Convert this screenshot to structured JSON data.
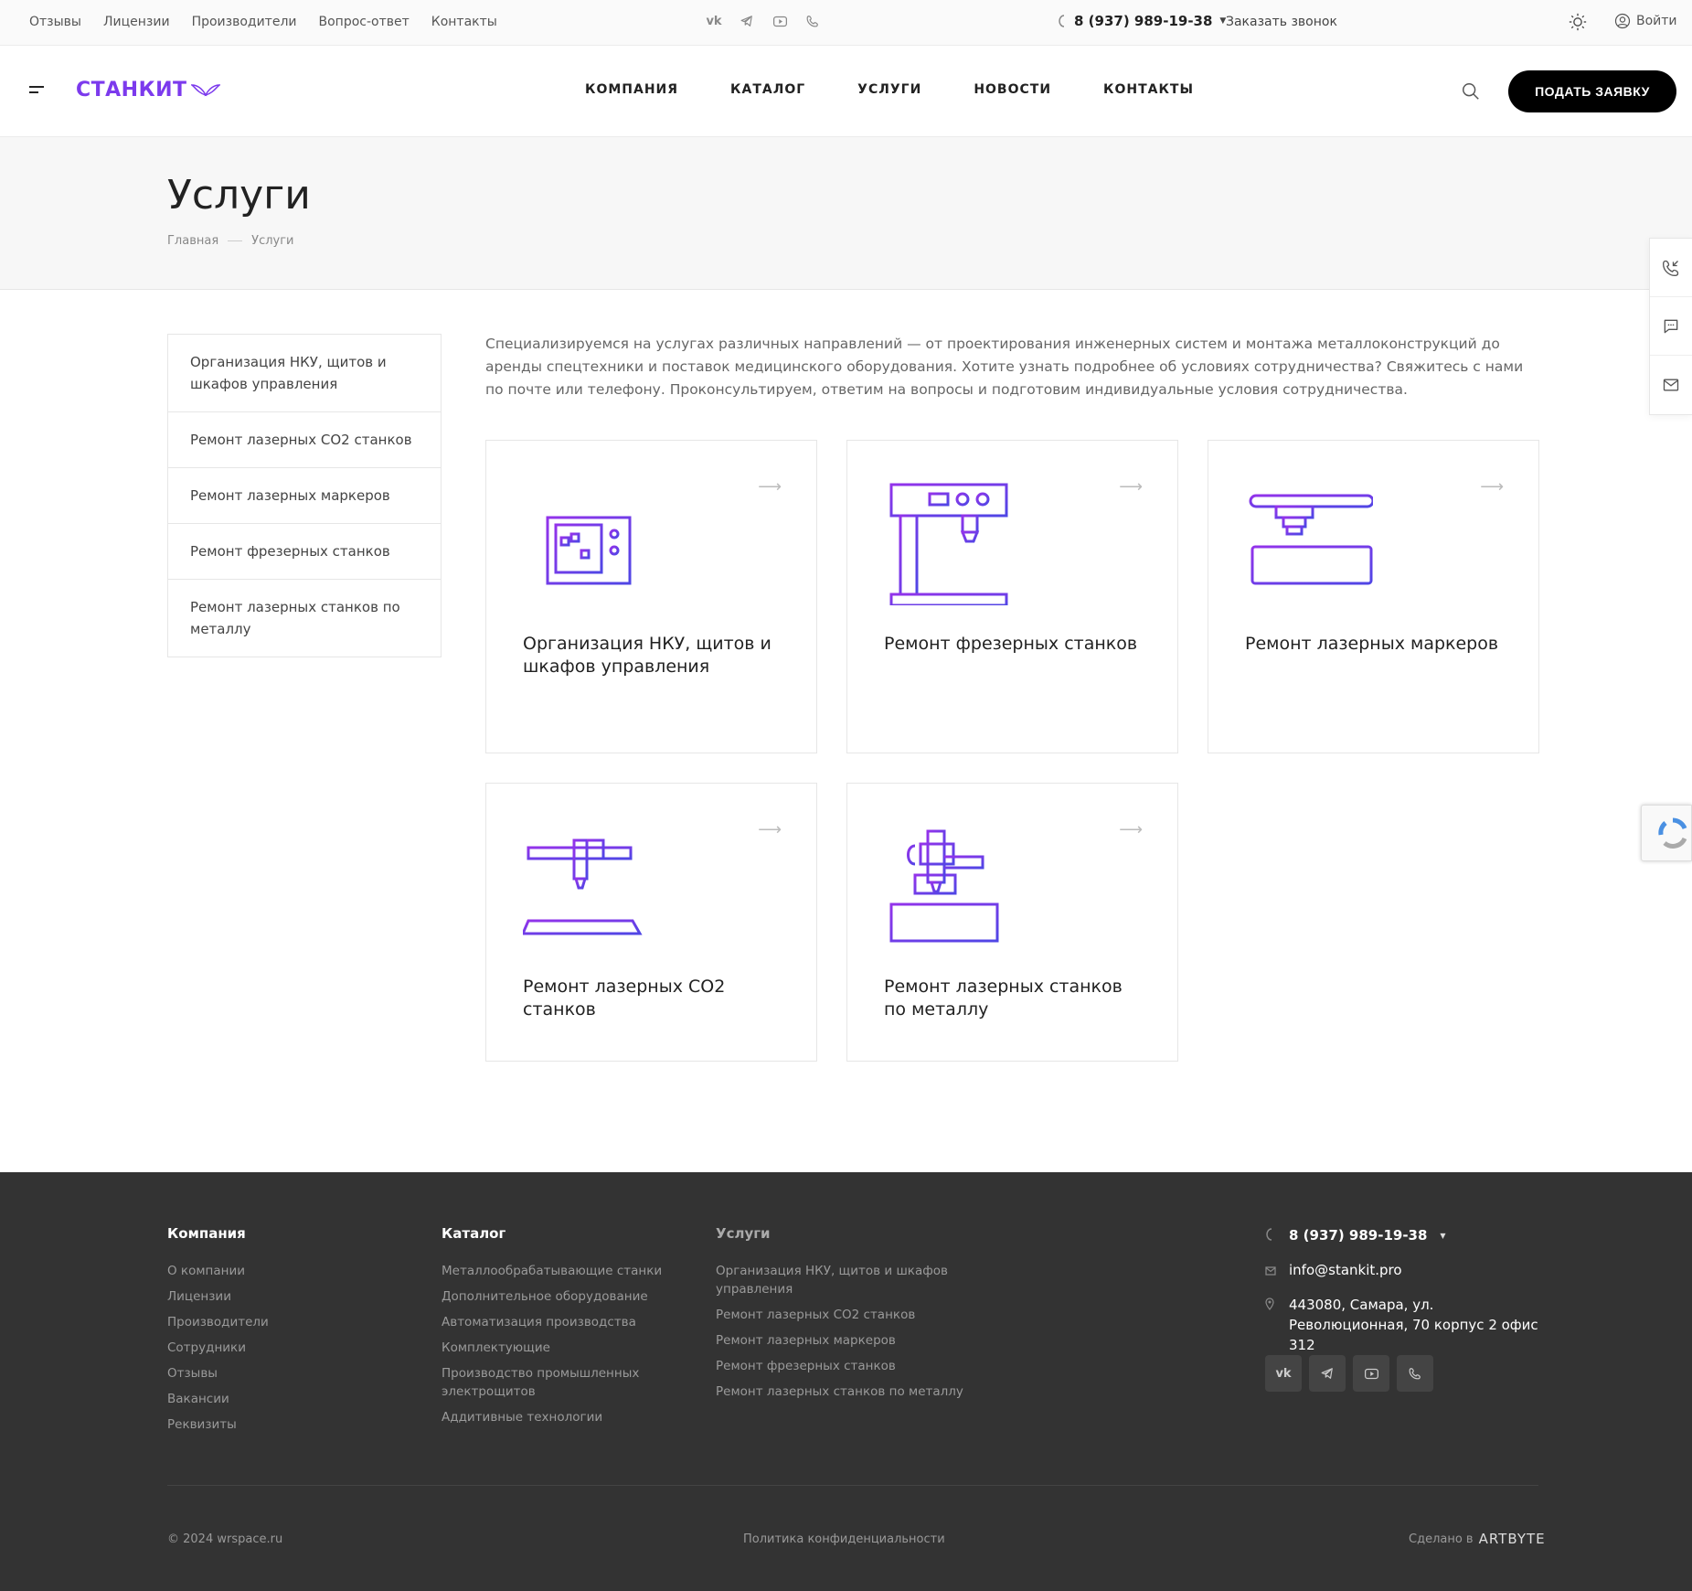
{
  "topbar": {
    "links": [
      "Отзывы",
      "Лицензии",
      "Производители",
      "Вопрос-ответ",
      "Контакты"
    ],
    "phone": "8 (937) 989-19-38",
    "callback": "Заказать звонок",
    "login": "Войти"
  },
  "header": {
    "logo": "СТАНКИТ",
    "nav": [
      "КОМПАНИЯ",
      "КАТАЛОГ",
      "УСЛУГИ",
      "НОВОСТИ",
      "КОНТАКТЫ"
    ],
    "cta": "ПОДАТЬ ЗАЯВКУ"
  },
  "page": {
    "title": "Услуги",
    "breadcrumbs": [
      "Главная",
      "Услуги"
    ]
  },
  "sidebar": {
    "items": [
      "Организация НКУ, щитов и шкафов управления",
      "Ремонт лазерных CO2 станков",
      "Ремонт лазерных маркеров",
      "Ремонт фрезерных станков",
      "Ремонт лазерных станков по металлу"
    ]
  },
  "intro": "Специализируемся на услугах различных направлений — от проектирования инженерных систем и монтажа металлоконструкций до аренды спецтехники и поставок медицинского оборудования. Хотите узнать подробнее об условиях сотрудничества? Свяжитесь с нами по почте или телефону. Проконсультируем, ответим на вопросы и подготовим индивидуальные условия сотрудничества.",
  "cards": [
    {
      "title": "Организация НКУ, щитов и шкафов управления",
      "icon": "control-panel-icon"
    },
    {
      "title": "Ремонт фрезерных станков",
      "icon": "milling-machine-icon"
    },
    {
      "title": "Ремонт лазерных маркеров",
      "icon": "laser-marker-icon"
    },
    {
      "title": "Ремонт лазерных CO2 станков",
      "icon": "co2-laser-icon"
    },
    {
      "title": "Ремонт лазерных станков по металлу",
      "icon": "metal-laser-icon"
    }
  ],
  "footer": {
    "company": {
      "title": "Компания",
      "links": [
        "О компании",
        "Лицензии",
        "Производители",
        "Сотрудники",
        "Отзывы",
        "Вакансии",
        "Реквизиты"
      ]
    },
    "catalog": {
      "title": "Каталог",
      "links": [
        "Металлообрабатывающие станки",
        "Дополнительное оборудование",
        "Автоматизация производства",
        "Комплектующие",
        "Производство промышленных электрощитов",
        "Аддитивные технологии"
      ]
    },
    "services": {
      "title": "Услуги",
      "links": [
        "Организация НКУ, щитов и шкафов управления",
        "Ремонт лазерных CO2 станков",
        "Ремонт лазерных маркеров",
        "Ремонт фрезерных станков",
        "Ремонт лазерных станков по металлу"
      ]
    },
    "phone": "8 (937) 989-19-38",
    "email": "info@stankit.pro",
    "address": "443080, Самара, ул. Революционная, 70 корпус 2 офис 312",
    "copyright": "© 2024 wrspace.ru",
    "policy": "Политика конфиденциальности",
    "made_by": "Сделано в",
    "made_by_brand": "ARTBYTE"
  },
  "colors": {
    "accent": "#7c3aed",
    "accent_end": "#4f46e5",
    "footer_bg": "#333333"
  }
}
